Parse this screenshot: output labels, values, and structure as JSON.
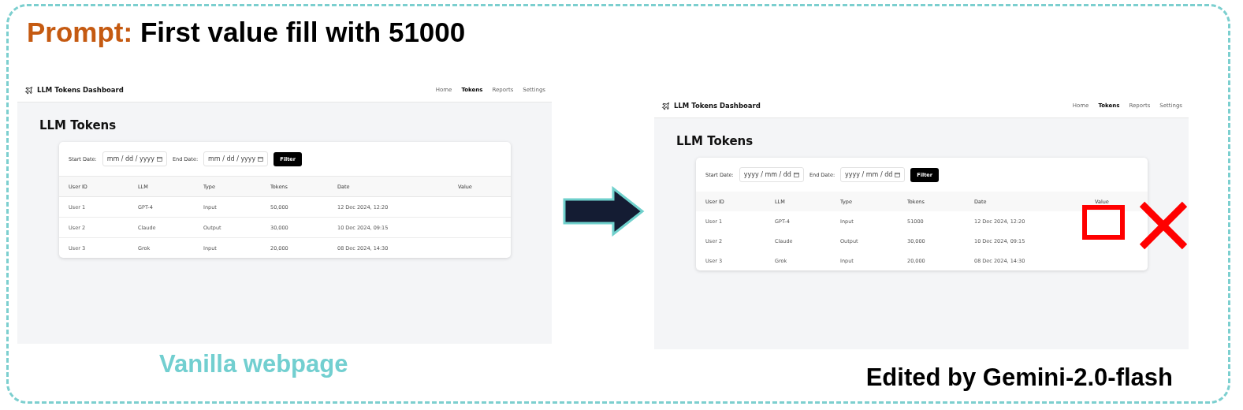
{
  "prompt": {
    "label": "Prompt:",
    "text": "First value fill with 51000"
  },
  "panels": [
    {
      "kind": "original",
      "brand": "LLM Tokens Dashboard",
      "nav": [
        {
          "label": "Home",
          "selected": false
        },
        {
          "label": "Tokens",
          "selected": true
        },
        {
          "label": "Reports",
          "selected": false
        },
        {
          "label": "Settings",
          "selected": false
        }
      ],
      "heading": "LLM Tokens",
      "start_label": "Start Date:",
      "start_placeholder": "mm / dd / yyyy",
      "end_label": "End Date:",
      "end_placeholder": "mm / dd / yyyy",
      "button": "Filter",
      "columns": [
        "User ID",
        "LLM",
        "Type",
        "Tokens",
        "Date",
        "Value"
      ],
      "rows": [
        {
          "cells": [
            "User 1",
            "GPT-4",
            "Input",
            "50,000",
            "12 Dec 2024, 12:20"
          ]
        },
        {
          "cells": [
            "User 2",
            "Claude",
            "Output",
            "30,000",
            "10 Dec 2024, 09:15"
          ]
        },
        {
          "cells": [
            "User 3",
            "Grok",
            "Input",
            "20,000",
            "08 Dec 2024, 14:30"
          ]
        }
      ],
      "caption": "Vanilla webpage"
    },
    {
      "kind": "edited",
      "rejected": true,
      "brand": "LLM Tokens Dashboard",
      "nav": [
        {
          "label": "Home",
          "selected": false
        },
        {
          "label": "Tokens",
          "selected": true
        },
        {
          "label": "Reports",
          "selected": false
        },
        {
          "label": "Settings",
          "selected": false
        }
      ],
      "heading": "LLM Tokens",
      "start_label": "Start Date:",
      "start_placeholder": "yyyy / mm / dd",
      "end_label": "End Date:",
      "end_placeholder": "yyyy / mm / dd",
      "button": "Filter",
      "columns": [
        "User ID",
        "LLM",
        "Type",
        "Tokens",
        "Date",
        "Value"
      ],
      "rows": [
        {
          "cells": [
            "User 1",
            "GPT-4",
            "Input",
            "51000",
            "12 Dec 2024, 12:20"
          ]
        },
        {
          "cells": [
            "User 2",
            "Claude",
            "Output",
            "30,000",
            "10 Dec 2024, 09:15"
          ]
        },
        {
          "cells": [
            "User 3",
            "Grok",
            "Input",
            "20,000",
            "08 Dec 2024, 14:30"
          ]
        }
      ],
      "caption": "Edited by Gemini-2.0-flash"
    }
  ]
}
